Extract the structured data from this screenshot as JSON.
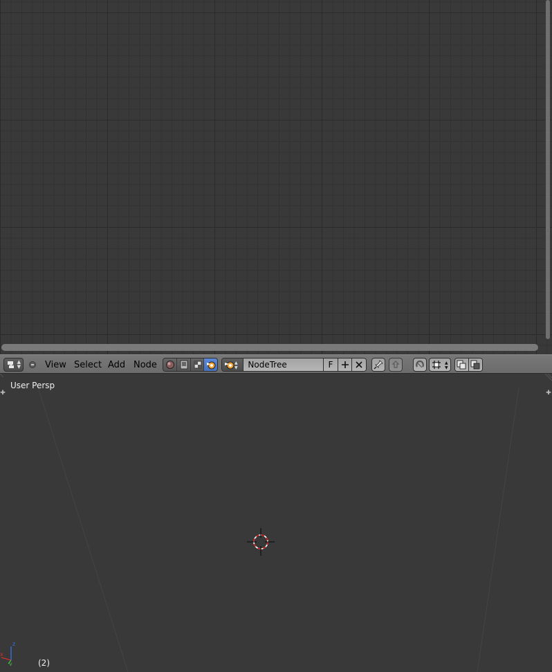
{
  "header": {
    "menus": [
      "View",
      "Select",
      "Add",
      "Node"
    ],
    "node_tree": {
      "name": "NodeTree",
      "fake_user_label": "F"
    }
  },
  "viewport": {
    "view_label": "User Persp",
    "frame_label": "(2)"
  },
  "icons": {
    "editor_type": "node-editor-type-icon",
    "shader_types": [
      "object-shader-icon",
      "world-shader-icon",
      "texture-icon",
      "render-engine-icon"
    ],
    "accent_color": "#5680c2"
  }
}
